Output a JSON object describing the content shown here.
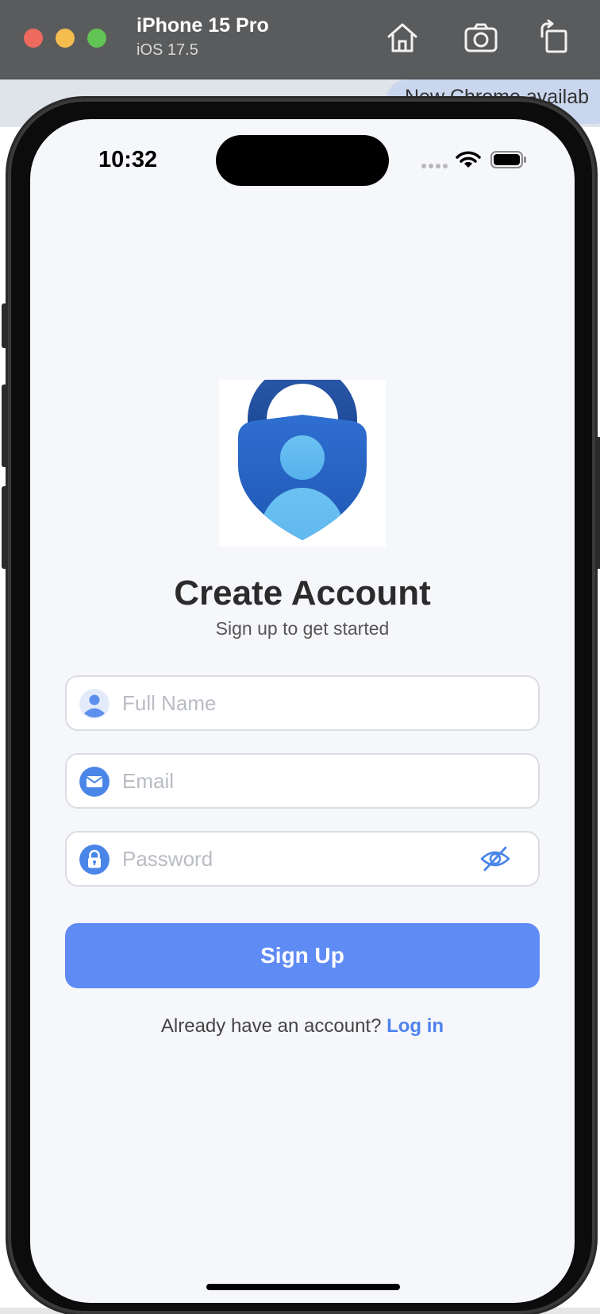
{
  "simulator": {
    "device_name": "iPhone 15 Pro",
    "os_version": "iOS 17.5",
    "toolbar_icons": [
      "home-icon",
      "screenshot-icon",
      "rotate-icon"
    ]
  },
  "background_browser": {
    "chrome_banner": "New Chrome availab"
  },
  "status_bar": {
    "time": "10:32"
  },
  "app": {
    "logo_icon": "lock-person-icon",
    "title": "Create Account",
    "subtitle": "Sign up to get started",
    "fields": {
      "full_name_placeholder": "Full Name",
      "email_placeholder": "Email",
      "password_placeholder": "Password"
    },
    "signup_label": "Sign Up",
    "login_prompt": "Already have an account?",
    "login_link": "Log in"
  },
  "colors": {
    "primary": "#5f8bf5",
    "link": "#4f82ee",
    "screen_bg": "#f6f7fb",
    "title_text": "#2b2b2b"
  }
}
